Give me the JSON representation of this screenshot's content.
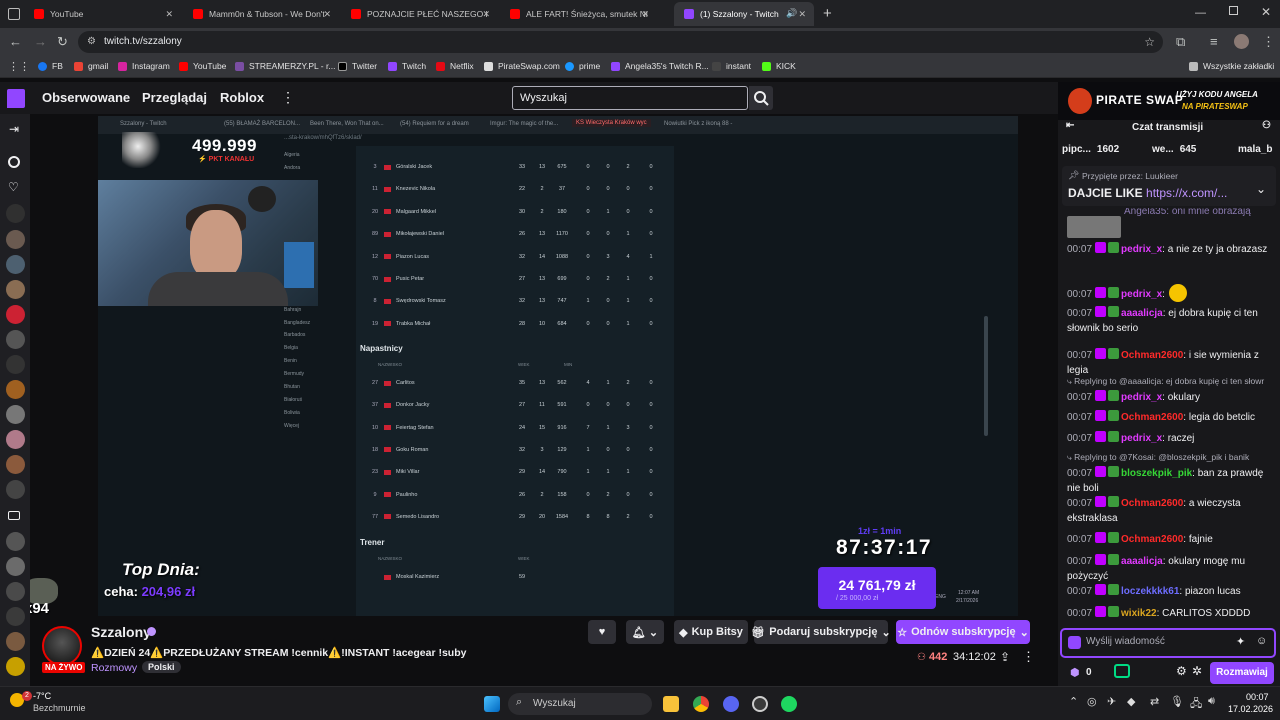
{
  "browser": {
    "tabs": [
      {
        "title": "YouTube"
      },
      {
        "title": "Mamm0n & Tubson - We Don't"
      },
      {
        "title": "POZNAJCIE PŁEĆ NASZEGO DZ"
      },
      {
        "title": "ALE FART! Śnieżyca, smutek Nie"
      },
      {
        "title": "(1) Szzalony - Twitch"
      }
    ],
    "new_tab": "+",
    "url": "twitch.tv/szzalony",
    "bookmarks": [
      "FB",
      "gmail",
      "Instagram",
      "YouTube",
      "STREAMERZY.PL - r...",
      "Twitter",
      "Twitch",
      "Netflix",
      "PirateSwap.com",
      "prime",
      "Angela35's Twitch R...",
      "instant",
      "KICK"
    ],
    "all_bookmarks": "Wszystkie zakładki"
  },
  "twitch_nav": {
    "links": [
      "Obserwowane",
      "Przeglądaj",
      "Roblox"
    ],
    "search_placeholder": "Wyszukaj"
  },
  "video": {
    "inner_tabs": [
      "Szzalony - Twitch",
      "(55) BŁAMAŻ BARCELON...",
      "Been There, Won That on...",
      "(54) Requiem for a dream",
      "Imgur: The magic of the...",
      "KS Wieczysta Kraków wyc",
      "Nowiutki Pick z ikoną 88 -"
    ],
    "inner_url": "...sta-krakow/mhQfTz6/sklad/",
    "points": "499.999",
    "points_label": "PKT KANAŁU",
    "countries": [
      "Algeria",
      "Andora",
      "",
      "",
      "",
      "",
      "",
      "",
      "",
      "",
      "Austria",
      "Azerbejdżan",
      "Bahrajn",
      "Bangladesz",
      "Barbados",
      "Belgia",
      "Benin",
      "Bermudy",
      "Bhutan",
      "Białoruś",
      "Boliwia",
      "Więcej"
    ],
    "defenders": [
      {
        "n": "3",
        "name": "Góralski Jacek",
        "v": [
          "33",
          "13",
          "675",
          "0",
          "0",
          "2",
          "0"
        ]
      },
      {
        "n": "11",
        "name": "Knezevic Nikola",
        "v": [
          "22",
          "2",
          "37",
          "0",
          "0",
          "0",
          "0"
        ]
      },
      {
        "n": "20",
        "name": "Malgaard Mikkel",
        "v": [
          "30",
          "2",
          "180",
          "0",
          "1",
          "0",
          "0"
        ]
      },
      {
        "n": "89",
        "name": "Mikołajewski Daniel",
        "v": [
          "26",
          "13",
          "1170",
          "0",
          "0",
          "1",
          "0"
        ]
      },
      {
        "n": "12",
        "name": "Piazon Lucas",
        "v": [
          "32",
          "14",
          "1088",
          "0",
          "3",
          "4",
          "1"
        ]
      },
      {
        "n": "70",
        "name": "Pusic Petar",
        "v": [
          "27",
          "13",
          "699",
          "0",
          "2",
          "1",
          "0"
        ]
      },
      {
        "n": "8",
        "name": "Swędrowski Tomasz",
        "v": [
          "32",
          "13",
          "747",
          "1",
          "0",
          "1",
          "0"
        ]
      },
      {
        "n": "19",
        "name": "Trabka Michał",
        "v": [
          "28",
          "10",
          "684",
          "0",
          "0",
          "1",
          "0"
        ]
      }
    ],
    "forwards_title": "Napastnicy",
    "header_name": "NAZWISKO",
    "header_age": "WIEK",
    "header_min": "MIN",
    "forwards": [
      {
        "n": "27",
        "name": "Carlitos",
        "v": [
          "35",
          "13",
          "562",
          "4",
          "1",
          "2",
          "0"
        ]
      },
      {
        "n": "37",
        "name": "Donkor Jacky",
        "v": [
          "27",
          "11",
          "591",
          "0",
          "0",
          "0",
          "0"
        ]
      },
      {
        "n": "10",
        "name": "Feiertag Stefan",
        "v": [
          "24",
          "15",
          "916",
          "7",
          "1",
          "3",
          "0"
        ]
      },
      {
        "n": "18",
        "name": "Goku Roman",
        "v": [
          "32",
          "3",
          "129",
          "1",
          "0",
          "0",
          "0"
        ]
      },
      {
        "n": "23",
        "name": "Miki Villar",
        "v": [
          "29",
          "14",
          "790",
          "1",
          "1",
          "1",
          "0"
        ]
      },
      {
        "n": "9",
        "name": "Paulinho",
        "v": [
          "26",
          "2",
          "158",
          "0",
          "2",
          "0",
          "0"
        ]
      },
      {
        "n": "77",
        "name": "Semedo Lisandro",
        "v": [
          "29",
          "20",
          "1584",
          "8",
          "8",
          "2",
          "0"
        ]
      }
    ],
    "coach_title": "Trener",
    "coach": {
      "name": "Moskal Kazimierz",
      "age": "59"
    },
    "top_dnia": "Top Dnia:",
    "top_name": "ceha: ",
    "top_value": "204,96 zł",
    "timer_hint": "1zł = 1min",
    "timer": "87:37:17",
    "donation_total": "24 761,79 zł",
    "donation_sub": "/ 25 000,00 zł",
    "clock": "12:07 AM",
    "clock_date": "2/17/2026",
    "lang": "ENG",
    "x94": "x94"
  },
  "stream": {
    "channel": "Szzalony",
    "live_badge": "NA ŻYWO",
    "title": "⚠️DZIEŃ 24⚠️PRZEDŁUŻANY STREAM !cennik⚠️!INSTANT !acegear !suby",
    "category": "Rozmowy",
    "tag": "Polski",
    "viewers": "442",
    "uptime": "34:12:02",
    "kup_bitsy": "Kup Bitsy",
    "podaruj": "Podaruj subskrypcję",
    "odnow": "Odnów subskrypcję"
  },
  "chat": {
    "banner_title": "PIRATE SWAP",
    "banner_promo_1": "UŻYJ KODU ANGELA",
    "banner_promo_2": "NA PIRATESWAP",
    "header": "Czat transmisji",
    "leaders": [
      {
        "name": "pipc...",
        "value": "1602"
      },
      {
        "name": "we...",
        "value": "645"
      },
      {
        "name": "mala_b",
        "value": ""
      }
    ],
    "pinned_by": "Przypięte przez: Luukieer",
    "pinned_text": "DAJCIE LIKE ",
    "pinned_link": "https://x.com/...",
    "partial_msg": "Angela35: oni mnie obrażają",
    "messages": [
      {
        "time": "00:07",
        "user": "pedrix_x",
        "color": "#e13bff",
        "text": ": a nie ze ty ja obrazasz"
      },
      {
        "time": "00:07",
        "user": "pedrix_x",
        "color": "#e13bff",
        "text": ":"
      },
      {
        "time": "00:07",
        "user": "aaaalicja",
        "color": "#e13bff",
        "text": ": ej dobra kupię ci ten słownik bo serio"
      },
      {
        "time": "00:07",
        "user": "Ochman2600",
        "color": "#ff2a2a",
        "text": ": i sie wymienia z legia"
      },
      {
        "reply": "Replying to @aaaalicja: ej dobra kupię ci ten słowr"
      },
      {
        "time": "00:07",
        "user": "pedrix_x",
        "color": "#e13bff",
        "text": ": okulary"
      },
      {
        "time": "00:07",
        "user": "Ochman2600",
        "color": "#ff2a2a",
        "text": ": legia do betclic"
      },
      {
        "time": "00:07",
        "user": "pedrix_x",
        "color": "#e13bff",
        "text": ": raczej"
      },
      {
        "reply": "Replying to @7Kosai: @bloszekpik_pik i banik"
      },
      {
        "time": "00:07",
        "user": "bloszekpik_pik",
        "color": "#36d636",
        "text": ": ban za prawdę nie boli"
      },
      {
        "time": "00:07",
        "user": "Ochman2600",
        "color": "#ff2a2a",
        "text": ": a wieczysta ekstraklasa"
      },
      {
        "time": "00:07",
        "user": "Ochman2600",
        "color": "#ff2a2a",
        "text": ": fajnie"
      },
      {
        "time": "00:07",
        "user": "aaaalicja",
        "color": "#e13bff",
        "text": ": okulary mogę mu pożyczyć"
      },
      {
        "time": "00:07",
        "user": "loczekkkk61",
        "color": "#6d6dff",
        "text": ": piazon lucas"
      },
      {
        "time": "00:07",
        "user": "wixik22",
        "color": "#daa520",
        "text": ": CARLITOS XDDDD"
      }
    ],
    "input_placeholder": "Wyślij wiadomość",
    "points": "0",
    "send_label": "Rozmawiaj"
  },
  "taskbar": {
    "weather_temp": "-7°C",
    "weather_text": "Bezchmurnie",
    "weather_badge": "2",
    "search": "Wyszukaj",
    "time": "00:07",
    "date": "17.02.2026"
  }
}
